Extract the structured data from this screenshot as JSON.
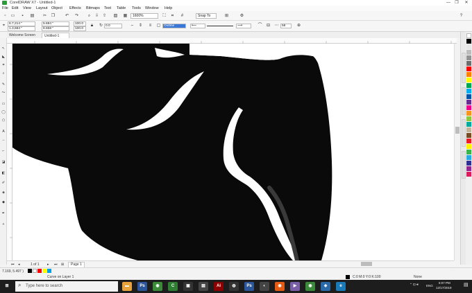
{
  "app": {
    "title": "CorelDRAW X7 - Untitled-1",
    "window_buttons": [
      "—",
      "❐",
      "✕"
    ]
  },
  "menu": [
    "File",
    "Edit",
    "View",
    "Layout",
    "Object",
    "Effects",
    "Bitmaps",
    "Text",
    "Table",
    "Tools",
    "Window",
    "Help"
  ],
  "toolbar": {
    "zoom_value": "1600%",
    "snap_to_label": "Snap To",
    "new_icon": "new-document-icon",
    "open_icon": "open-folder-icon",
    "save_icon": "save-icon"
  },
  "property_bar": {
    "x_value": "6.7,214 \"",
    "y_value": "1.3,684 \"",
    "w_value": "5.684 \"",
    "h_value": "8.658 \"",
    "scale_x": "100.0",
    "scale_y": "100.0",
    "rotation": "0.0",
    "outline_label": "Outline",
    "nodes_value": "58"
  },
  "doc_tabs": [
    {
      "label": "Welcome Screen",
      "active": false
    },
    {
      "label": "Untitled-1",
      "active": true
    }
  ],
  "page_nav": {
    "counter": "1 of 1",
    "page_label": "Page 1"
  },
  "status": {
    "cursor_pos": "7.169, 5.497 )",
    "object_info": "Curve on Layer 1",
    "fill_label": "None",
    "color_model": "C:0 M:0 Y:0 K:100"
  },
  "taskbar": {
    "search_placeholder": "Type here to search",
    "time": "6:07 PM",
    "date": "12/17/2019",
    "lang": "ENG"
  },
  "palette_colors": [
    "#ffffff",
    "#000000",
    "#e6e6e6",
    "#bdbdbd",
    "#939393",
    "#6d6d6d",
    "#ff0000",
    "#ff7f00",
    "#ffff00",
    "#00a650",
    "#00aeef",
    "#0054a6",
    "#662d91",
    "#ec008c",
    "#f7941d",
    "#8dc63f",
    "#00a99d",
    "#c2b59b",
    "#754c24",
    "#ed1c24",
    "#fff200",
    "#39b54a",
    "#27aae1",
    "#2e3192",
    "#92278f",
    "#da1c5c"
  ]
}
